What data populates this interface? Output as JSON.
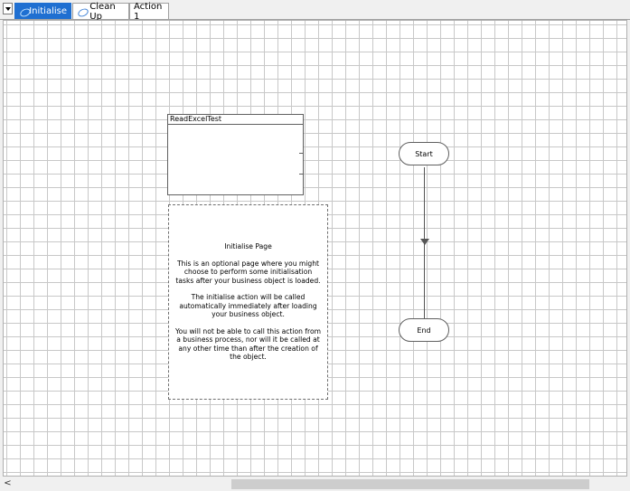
{
  "tabs": [
    {
      "label": "Initialise",
      "icon": "page-icon",
      "active": true
    },
    {
      "label": "Clean Up",
      "icon": "page-icon",
      "active": false
    },
    {
      "label": "Action 1",
      "icon": "",
      "active": false
    }
  ],
  "diagram": {
    "object_box": {
      "title": "ReadExcelTest"
    },
    "note": {
      "heading": "Initialise Page",
      "paragraphs": [
        "This is an optional page where you might choose to perform some initialisation tasks after your business object is loaded.",
        "The initialise action will be called automatically immediately after loading your business object.",
        "You will not be able to call this action from a business process, nor will it be called at any other time than after the creation of the object."
      ]
    },
    "start": {
      "label": "Start"
    },
    "end": {
      "label": "End"
    }
  },
  "scrollbar": {
    "left_arrow": "<"
  }
}
